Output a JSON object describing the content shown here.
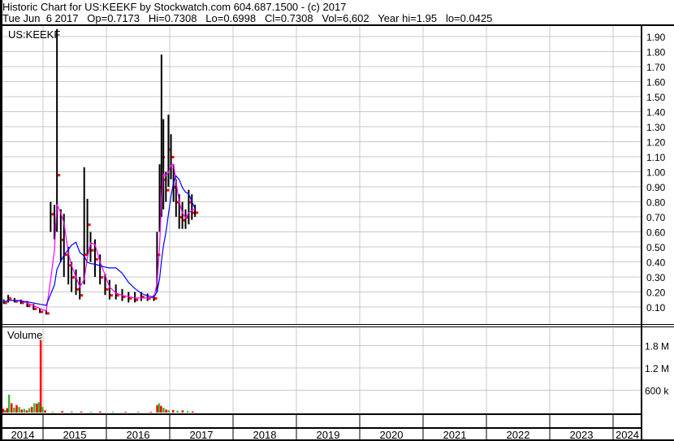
{
  "header": {
    "title": "Historic Chart for US:KEEKF by Stockwatch.com 604.687.1500 - (c) 2017",
    "quote": "Tue Jun  6 2017   Op=0.7173   Hi=0.7308   Lo=0.6998   Cl=0.7308   Vol=6,602   Year hi=1.95   lo=0.0425"
  },
  "colors": {
    "price_bar": "#000000",
    "close_dot": "#ff0000",
    "ma_short": "#ff00ff",
    "ma_long": "#0000ff",
    "vol_up": "#33bb33",
    "vol_down": "#ff0000",
    "grid": "#c8c8c8"
  },
  "chart_data": [
    {
      "type": "line",
      "title": "US:KEEKF",
      "ylim": [
        0,
        1.95
      ],
      "ytick_labels": [
        "1.90",
        "1.80",
        "1.70",
        "1.60",
        "1.50",
        "1.40",
        "1.30",
        "1.20",
        "1.10",
        "1.00",
        "0.90",
        "0.80",
        "0.70",
        "0.60",
        "0.50",
        "0.40",
        "0.30",
        "0.20",
        "0.10"
      ],
      "yticks": [
        1.9,
        1.8,
        1.7,
        1.6,
        1.5,
        1.4,
        1.3,
        1.2,
        1.1,
        1.0,
        0.9,
        0.8,
        0.7,
        0.6,
        0.5,
        0.4,
        0.3,
        0.2,
        0.1
      ],
      "x_labels": [
        "2014",
        "2015",
        "2016",
        "2017",
        "2018",
        "2019",
        "2020",
        "2021",
        "2022",
        "2023",
        "2024"
      ],
      "xlim": [
        2014.32,
        2024.4
      ],
      "ma_windows": {
        "short": 3,
        "long": 8
      },
      "ohlc_fields": [
        "year",
        "high",
        "low",
        "close"
      ],
      "points": [
        [
          2014.38,
          0.15,
          0.12,
          0.13
        ],
        [
          2014.45,
          0.18,
          0.13,
          0.16
        ],
        [
          2014.55,
          0.16,
          0.13,
          0.14
        ],
        [
          2014.65,
          0.15,
          0.12,
          0.13
        ],
        [
          2014.75,
          0.14,
          0.1,
          0.11
        ],
        [
          2014.85,
          0.12,
          0.08,
          0.09
        ],
        [
          2014.95,
          0.09,
          0.06,
          0.07
        ],
        [
          2015.05,
          0.08,
          0.05,
          0.06
        ],
        [
          2015.12,
          0.8,
          0.6,
          0.72
        ],
        [
          2015.18,
          0.78,
          0.55,
          0.65
        ],
        [
          2015.22,
          1.95,
          0.6,
          0.98
        ],
        [
          2015.28,
          0.75,
          0.4,
          0.55
        ],
        [
          2015.33,
          0.72,
          0.3,
          0.45
        ],
        [
          2015.4,
          0.5,
          0.25,
          0.38
        ],
        [
          2015.45,
          0.4,
          0.2,
          0.3
        ],
        [
          2015.52,
          0.35,
          0.18,
          0.22
        ],
        [
          2015.58,
          0.3,
          0.15,
          0.18
        ],
        [
          2015.65,
          1.03,
          0.25,
          0.45
        ],
        [
          2015.7,
          0.82,
          0.45,
          0.65
        ],
        [
          2015.75,
          0.6,
          0.4,
          0.48
        ],
        [
          2015.82,
          0.55,
          0.3,
          0.42
        ],
        [
          2015.9,
          0.45,
          0.25,
          0.3
        ],
        [
          2015.98,
          0.32,
          0.18,
          0.22
        ],
        [
          2016.05,
          0.28,
          0.15,
          0.18
        ],
        [
          2016.15,
          0.25,
          0.15,
          0.18
        ],
        [
          2016.25,
          0.22,
          0.14,
          0.17
        ],
        [
          2016.35,
          0.2,
          0.13,
          0.16
        ],
        [
          2016.45,
          0.2,
          0.13,
          0.15
        ],
        [
          2016.55,
          0.2,
          0.14,
          0.17
        ],
        [
          2016.65,
          0.19,
          0.14,
          0.16
        ],
        [
          2016.75,
          0.18,
          0.14,
          0.16
        ],
        [
          2016.8,
          0.6,
          0.2,
          0.45
        ],
        [
          2016.84,
          1.05,
          0.6,
          0.9
        ],
        [
          2016.87,
          1.78,
          0.7,
          1.1
        ],
        [
          2016.9,
          1.35,
          0.75,
          0.95
        ],
        [
          2016.94,
          1.0,
          0.8,
          0.88
        ],
        [
          2016.98,
          1.38,
          0.9,
          1.15
        ],
        [
          2017.02,
          1.25,
          0.95,
          1.1
        ],
        [
          2017.06,
          1.05,
          0.8,
          0.9
        ],
        [
          2017.1,
          0.95,
          0.7,
          0.8
        ],
        [
          2017.15,
          0.85,
          0.62,
          0.7
        ],
        [
          2017.2,
          0.8,
          0.62,
          0.68
        ],
        [
          2017.25,
          0.75,
          0.62,
          0.7
        ],
        [
          2017.3,
          0.88,
          0.65,
          0.8
        ],
        [
          2017.35,
          0.85,
          0.68,
          0.73
        ],
        [
          2017.4,
          0.78,
          0.7,
          0.73
        ]
      ]
    },
    {
      "type": "bar",
      "title": "Volume",
      "ylim": [
        0,
        2000000
      ],
      "ytick_labels": [
        "1.8 M",
        "1.2 M",
        "600 k"
      ],
      "yticks": [
        1800000,
        1200000,
        600000
      ],
      "bar_fields": [
        "year",
        "volume",
        "direction"
      ],
      "bars": [
        [
          2014.34,
          150000,
          "up"
        ],
        [
          2014.37,
          100000,
          "down"
        ],
        [
          2014.4,
          60000,
          "up"
        ],
        [
          2014.43,
          120000,
          "down"
        ],
        [
          2014.46,
          480000,
          "up"
        ],
        [
          2014.5,
          250000,
          "down"
        ],
        [
          2014.54,
          130000,
          "up"
        ],
        [
          2014.58,
          200000,
          "down"
        ],
        [
          2014.62,
          150000,
          "up"
        ],
        [
          2014.66,
          80000,
          "down"
        ],
        [
          2014.7,
          100000,
          "up"
        ],
        [
          2014.74,
          60000,
          "down"
        ],
        [
          2014.78,
          120000,
          "up"
        ],
        [
          2014.82,
          150000,
          "down"
        ],
        [
          2014.86,
          250000,
          "up"
        ],
        [
          2014.9,
          240000,
          "down"
        ],
        [
          2014.93,
          280000,
          "up"
        ],
        [
          2014.96,
          1950000,
          "down"
        ],
        [
          2014.99,
          150000,
          "up"
        ],
        [
          2015.03,
          60000,
          "down"
        ],
        [
          2015.15,
          20000,
          "up"
        ],
        [
          2015.3,
          40000,
          "down"
        ],
        [
          2015.45,
          30000,
          "up"
        ],
        [
          2015.6,
          25000,
          "down"
        ],
        [
          2015.75,
          20000,
          "up"
        ],
        [
          2015.9,
          30000,
          "down"
        ],
        [
          2016.1,
          20000,
          "up"
        ],
        [
          2016.3,
          20000,
          "down"
        ],
        [
          2016.5,
          25000,
          "up"
        ],
        [
          2016.7,
          20000,
          "down"
        ],
        [
          2016.8,
          200000,
          "down"
        ],
        [
          2016.83,
          250000,
          "up"
        ],
        [
          2016.86,
          180000,
          "down"
        ],
        [
          2016.9,
          130000,
          "up"
        ],
        [
          2016.94,
          80000,
          "down"
        ],
        [
          2016.98,
          60000,
          "up"
        ],
        [
          2017.05,
          70000,
          "down"
        ],
        [
          2017.12,
          50000,
          "up"
        ],
        [
          2017.2,
          60000,
          "down"
        ],
        [
          2017.28,
          40000,
          "up"
        ],
        [
          2017.36,
          30000,
          "down"
        ]
      ]
    }
  ]
}
